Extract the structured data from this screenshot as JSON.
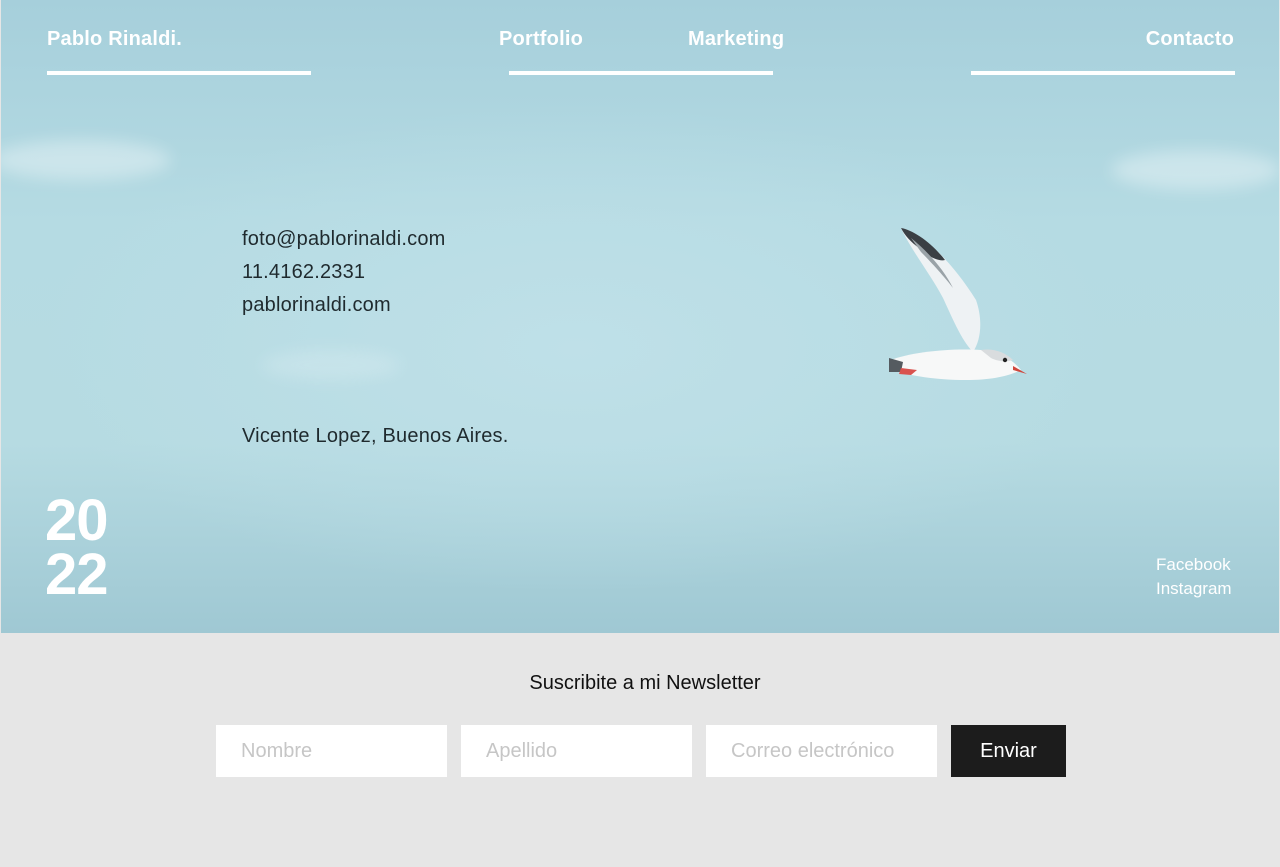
{
  "brand": {
    "name": "Pablo Rinaldi."
  },
  "nav": {
    "portfolio": "Portfolio",
    "marketing": "Marketing",
    "contacto": "Contacto"
  },
  "contact": {
    "email": "foto@pablorinaldi.com",
    "phone": "11.4162.2331",
    "website": "pablorinaldi.com",
    "location": "Vicente Lopez, Buenos Aires."
  },
  "year": {
    "top": "20",
    "bottom": "22"
  },
  "social": {
    "facebook": "Facebook",
    "instagram": "Instagram"
  },
  "newsletter": {
    "title": "Suscribite a mi Newsletter",
    "first_name_placeholder": "Nombre",
    "last_name_placeholder": "Apellido",
    "email_placeholder": "Correo electrónico",
    "submit_label": "Enviar"
  },
  "colors": {
    "sky": "#b6dbe2",
    "footer_bg": "#e6e6e6",
    "button_bg": "#1c1c1c",
    "text_dark": "#1f2a2e"
  },
  "icons": {
    "bird": "seagull-photo"
  }
}
